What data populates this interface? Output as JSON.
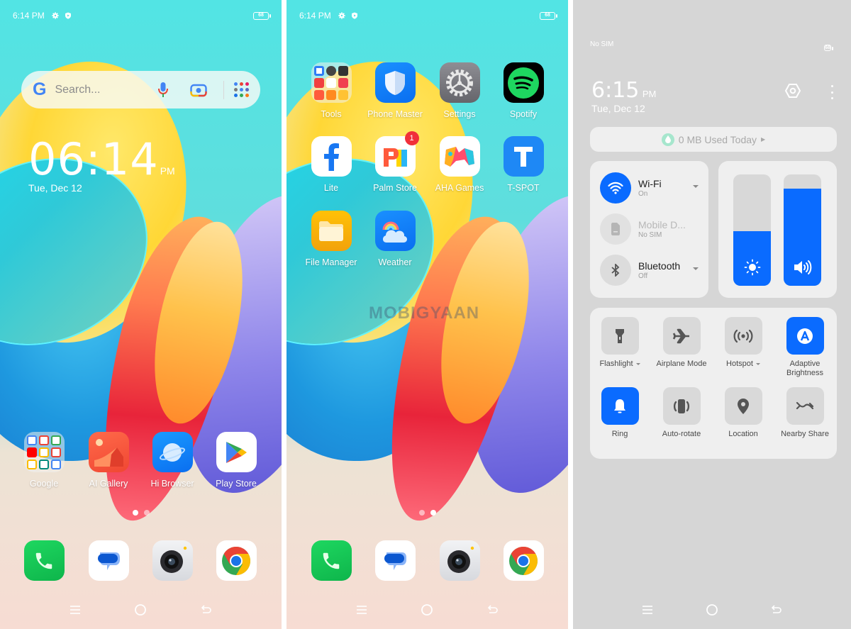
{
  "screens": [
    {
      "id": "home-page-1",
      "status": {
        "time": "6:14 PM",
        "icons": [
          "gear-icon",
          "shield-icon"
        ],
        "battery": "68"
      },
      "search": {
        "logo": "G",
        "placeholder": "Search..."
      },
      "clock": {
        "time": "06:14",
        "ampm": "PM",
        "date": "Tue, Dec 12"
      },
      "apps": [
        {
          "label": "Google",
          "icon": "google-folder-icon"
        },
        {
          "label": "AI Gallery",
          "icon": "gallery-icon"
        },
        {
          "label": "Hi Browser",
          "icon": "browser-icon"
        },
        {
          "label": "Play Store",
          "icon": "play-store-icon"
        }
      ],
      "page_indicator": {
        "pages": 2,
        "current": 1
      },
      "dock": [
        {
          "name": "Phone",
          "icon": "phone-icon"
        },
        {
          "name": "Messages",
          "icon": "messages-icon"
        },
        {
          "name": "Camera",
          "icon": "camera-icon"
        },
        {
          "name": "Chrome",
          "icon": "chrome-icon"
        }
      ],
      "nav": [
        "menu-icon",
        "home-icon",
        "back-icon"
      ]
    },
    {
      "id": "home-page-2",
      "status": {
        "time": "6:14 PM",
        "icons": [
          "gear-icon",
          "shield-icon"
        ],
        "battery": "68"
      },
      "apps": [
        {
          "label": "Tools",
          "icon": "tools-folder-icon"
        },
        {
          "label": "Phone Master",
          "icon": "shield-app-icon"
        },
        {
          "label": "Settings",
          "icon": "settings-icon"
        },
        {
          "label": "Spotify",
          "icon": "spotify-icon"
        },
        {
          "label": "Lite",
          "icon": "facebook-lite-icon"
        },
        {
          "label": "Palm Store",
          "icon": "palm-store-icon",
          "badge": "1"
        },
        {
          "label": "AHA Games",
          "icon": "aha-games-icon"
        },
        {
          "label": "T-SPOT",
          "icon": "t-spot-icon"
        },
        {
          "label": "File Manager",
          "icon": "folder-icon"
        },
        {
          "label": "Weather",
          "icon": "weather-icon"
        }
      ],
      "watermark": "MOBIGYAAN",
      "page_indicator": {
        "pages": 2,
        "current": 2
      },
      "nav": [
        "menu-icon",
        "home-icon",
        "back-icon"
      ]
    },
    {
      "id": "control-center",
      "status": {
        "carrier": "No SIM",
        "battery": "68"
      },
      "clock": {
        "time": "6:15",
        "ampm": "PM",
        "date": "Tue, Dec 12"
      },
      "data_usage": "0 MB Used Today",
      "connections": [
        {
          "title": "Wi-Fi",
          "sub": "On",
          "active": true,
          "has_menu": true
        },
        {
          "title": "Mobile D...",
          "sub": "No SIM",
          "active": false,
          "disabled": true,
          "has_menu": false
        },
        {
          "title": "Bluetooth",
          "sub": "Off",
          "active": false,
          "has_menu": true
        }
      ],
      "sliders": {
        "brightness_percent": 49,
        "volume_percent": 87
      },
      "tiles": [
        {
          "label": "Flashlight",
          "on": false,
          "has_menu": true
        },
        {
          "label": "Airplane Mode",
          "on": false,
          "has_menu": false
        },
        {
          "label": "Hotspot",
          "on": false,
          "has_menu": true
        },
        {
          "label": "Adaptive Brightness",
          "on": true,
          "has_menu": false
        },
        {
          "label": "Ring",
          "on": true,
          "has_menu": false
        },
        {
          "label": "Auto-rotate",
          "on": false,
          "has_menu": false
        },
        {
          "label": "Location",
          "on": false,
          "has_menu": false
        },
        {
          "label": "Nearby Share",
          "on": false,
          "has_menu": false
        }
      ],
      "nav": [
        "menu-icon",
        "home-icon",
        "back-icon"
      ]
    }
  ],
  "colors": {
    "accent": "#0a6bff",
    "panel_bg": "#d6d6d6",
    "card_bg": "#efefef",
    "badge": "#f0303a"
  }
}
